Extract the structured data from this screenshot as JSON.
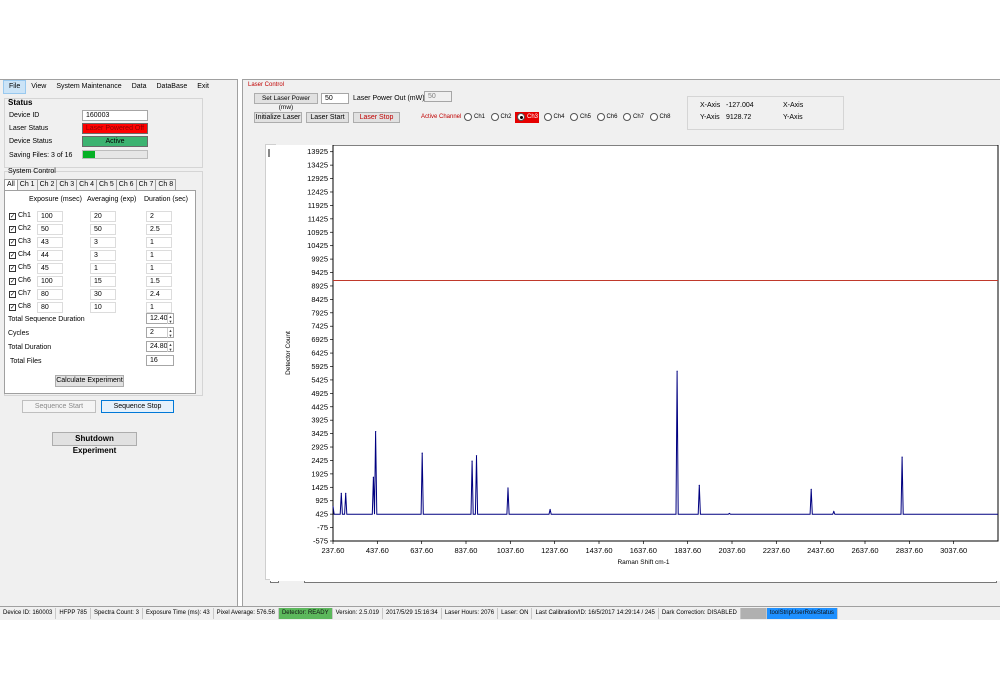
{
  "menu": [
    "File",
    "View",
    "System Maintenance",
    "Data",
    "DataBase",
    "Exit"
  ],
  "status": {
    "title": "Status",
    "device_id_label": "Device ID",
    "device_id_value": "160003",
    "laser_status_label": "Laser Status",
    "laser_status_value": "Laser Powered Off",
    "device_status_label": "Device Status",
    "device_status_value": "Active",
    "saving_files_label": "Saving Files: 3 of 16",
    "saving_progress": 0.1875,
    "colors": {
      "laser_off": "#ff0000",
      "active": "#3cb371",
      "progress": "#06b025"
    }
  },
  "system_control": {
    "title": "System Control",
    "tabs": [
      "All",
      "Ch 1",
      "Ch 2",
      "Ch 3",
      "Ch 4",
      "Ch 5",
      "Ch 6",
      "Ch 7",
      "Ch 8"
    ],
    "headers": [
      "Exposure (msec)",
      "Averaging (exp)",
      "Duration (sec)"
    ],
    "channels": [
      {
        "name": "Ch1",
        "exposure": "100",
        "averaging": "20",
        "duration": "2"
      },
      {
        "name": "Ch2",
        "exposure": "50",
        "averaging": "50",
        "duration": "2.5"
      },
      {
        "name": "Ch3",
        "exposure": "43",
        "averaging": "3",
        "duration": "1"
      },
      {
        "name": "Ch4",
        "exposure": "44",
        "averaging": "3",
        "duration": "1"
      },
      {
        "name": "Ch5",
        "exposure": "45",
        "averaging": "1",
        "duration": "1"
      },
      {
        "name": "Ch6",
        "exposure": "100",
        "averaging": "15",
        "duration": "1.5"
      },
      {
        "name": "Ch7",
        "exposure": "80",
        "averaging": "30",
        "duration": "2.4"
      },
      {
        "name": "Ch8",
        "exposure": "80",
        "averaging": "10",
        "duration": "1"
      }
    ],
    "total_sequence_duration_label": "Total Sequence Duration",
    "total_sequence_duration_value": "12.40",
    "cycles_label": "Cycles",
    "cycles_value": "2",
    "total_duration_label": "Total Duration",
    "total_duration_value": "24.80",
    "total_files_label": "Total Files",
    "total_files_value": "16",
    "calculate_button": "Calculate Experiment"
  },
  "sequence": {
    "start_button": "Sequence Start",
    "stop_button": "Sequence Stop"
  },
  "shutdown_button": "Shutdown Experiment",
  "laser_control": {
    "title": "Laser Control",
    "set_power_button": "Set Laser Power (mw)",
    "power_value": "50",
    "power_out_label": "Laser Power Out (mW)",
    "power_out_value": "50",
    "initialize_button": "Initialize Laser",
    "start_button": "Laser Start",
    "stop_button": "Laser Stop",
    "active_channel_label": "Active Channel",
    "channels": [
      "Ch1",
      "Ch2",
      "Ch3",
      "Ch4",
      "Ch5",
      "Ch6",
      "Ch7",
      "Ch8"
    ],
    "selected_channel": "Ch3"
  },
  "cursor": {
    "x_label": "X-Axis",
    "x_value": "-127.004",
    "y_label": "Y-Axis",
    "y_value": "9128.72",
    "x_label2": "X-Axis",
    "y_label2": "Y-Axis"
  },
  "chart_data": {
    "type": "line",
    "title": "",
    "xlabel": "Raman Shift cm-1",
    "ylabel": "Detector Count",
    "xlim": [
      237.6,
      3237.6
    ],
    "ylim": [
      -575,
      14175
    ],
    "xticks": [
      "237.60",
      "437.60",
      "637.60",
      "837.60",
      "1037.60",
      "1237.60",
      "1437.60",
      "1637.60",
      "1837.60",
      "2037.60",
      "2237.60",
      "2437.60",
      "2637.60",
      "2837.60",
      "3037.60"
    ],
    "xtick_values": [
      237.6,
      437.6,
      637.6,
      837.6,
      1037.6,
      1237.6,
      1437.6,
      1637.6,
      1837.6,
      2037.6,
      2237.6,
      2437.6,
      2637.6,
      2837.6,
      3037.6
    ],
    "yticks": [
      13925,
      13425,
      12925,
      12425,
      11925,
      11425,
      10925,
      10425,
      9925,
      9425,
      8925,
      8425,
      7925,
      7425,
      6925,
      6425,
      5925,
      5425,
      4925,
      4425,
      3925,
      3425,
      2925,
      2425,
      1925,
      1425,
      925,
      425,
      -75,
      -575
    ],
    "grid": false,
    "series": [
      {
        "color": "#000080",
        "baseline": 425,
        "peaks": [
          {
            "x": 275,
            "y": 1200
          },
          {
            "x": 295,
            "y": 1200
          },
          {
            "x": 420,
            "y": 1800
          },
          {
            "x": 430,
            "y": 3500
          },
          {
            "x": 640,
            "y": 2700
          },
          {
            "x": 865,
            "y": 2400
          },
          {
            "x": 885,
            "y": 2600
          },
          {
            "x": 1027,
            "y": 1400
          },
          {
            "x": 1217,
            "y": 600
          },
          {
            "x": 1790,
            "y": 5750
          },
          {
            "x": 1890,
            "y": 1500
          },
          {
            "x": 2026,
            "y": 450
          },
          {
            "x": 2395,
            "y": 1350
          },
          {
            "x": 2497,
            "y": 520
          },
          {
            "x": 2805,
            "y": 2550
          }
        ]
      }
    ],
    "reference_line": {
      "y": 9128.72,
      "color": "#c0392b"
    }
  },
  "statusbar": [
    "Device ID: 160003",
    "HFPP 785",
    "Spectra Count: 3",
    "Exposure Time (ms): 43",
    "Pixel Average: 576.56",
    "Detector: READY",
    "Version: 2.5.019",
    "2017/5/29 15:16:34",
    "Laser Hours: 2076",
    "Laser: ON",
    "Last Calibration/ID: 16/5/2017 14:29:14 / 245",
    "Dark Correction: DISABLED",
    "",
    "toolStripUserRoleStatus"
  ]
}
